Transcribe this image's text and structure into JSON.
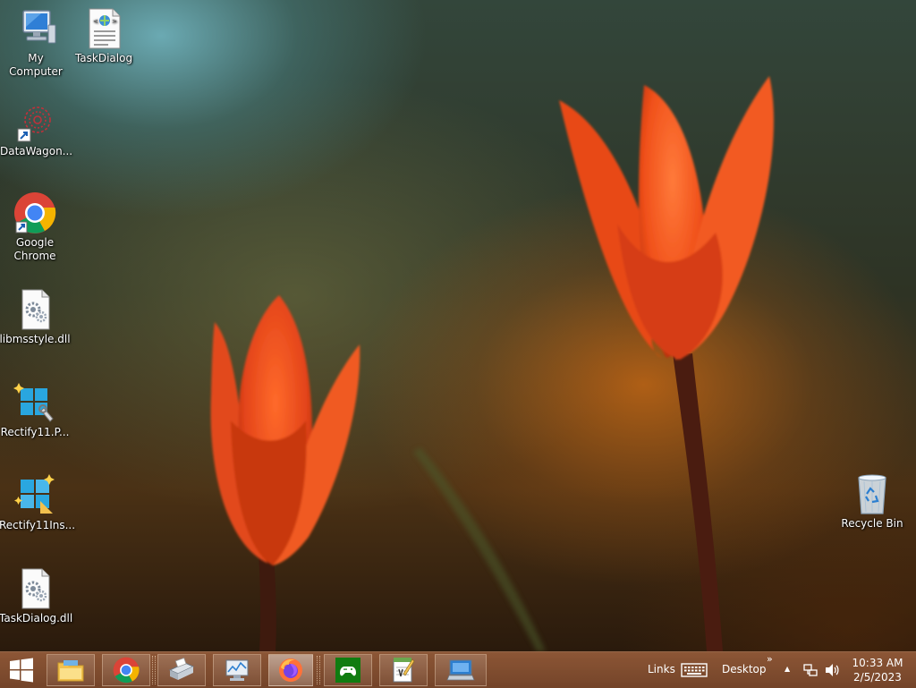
{
  "desktop_icons": [
    {
      "label": "My Computer"
    },
    {
      "label": "TaskDialog"
    },
    {
      "label": "DataWagon..."
    },
    {
      "label": "Google Chrome"
    },
    {
      "label": "libmsstyle.dll"
    },
    {
      "label": "Rectify11.P..."
    },
    {
      "label": "Rectify11Ins..."
    },
    {
      "label": "TaskDialog.dll"
    },
    {
      "label": "Recycle Bin"
    }
  ],
  "taskbar": {
    "pinned": [
      "start-icon",
      "file-explorer-icon",
      "chrome-icon",
      "scanner-icon",
      "performance-monitor-icon",
      "firefox-icon",
      "xbox-icon",
      "notepad-icon",
      "remote-desktop-icon"
    ],
    "active_app": "firefox-icon",
    "links_label": "Links",
    "desktop_label": "Desktop",
    "overflow_label": "»",
    "tray_expand": "▲",
    "clock": {
      "time": "10:33 AM",
      "date": "2/5/2023"
    }
  },
  "colors": {
    "taskbar": "#7a4526",
    "tulip": "#f0561a"
  }
}
